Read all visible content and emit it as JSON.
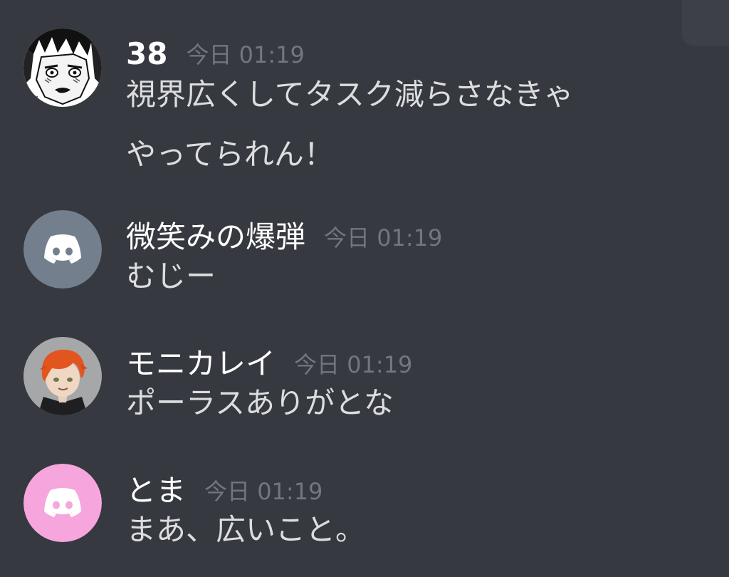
{
  "colors": {
    "background": "#36393f",
    "username": "#ffffff",
    "timestamp": "#72767d",
    "message_text": "#dcddde",
    "default_avatar_gray": "#747f8d",
    "default_avatar_pink": "#f6a6dc"
  },
  "messages": [
    {
      "username": "38",
      "timestamp": "今日 01:19",
      "lines": [
        "視界広くしてタスク減らさなきゃ",
        "やってられん！"
      ],
      "avatar": "manga-face-avatar"
    },
    {
      "username": "微笑みの爆弾",
      "timestamp": "今日 01:19",
      "lines": [
        "むじー"
      ],
      "avatar": "discord-default-gray-avatar"
    },
    {
      "username": "モニカレイ",
      "timestamp": "今日 01:19",
      "lines": [
        "ポーラスありがとな"
      ],
      "avatar": "orange-hair-character-avatar"
    },
    {
      "username": "とま",
      "timestamp": "今日 01:19",
      "lines": [
        "まあ、広いこと。"
      ],
      "avatar": "discord-default-pink-avatar"
    }
  ]
}
